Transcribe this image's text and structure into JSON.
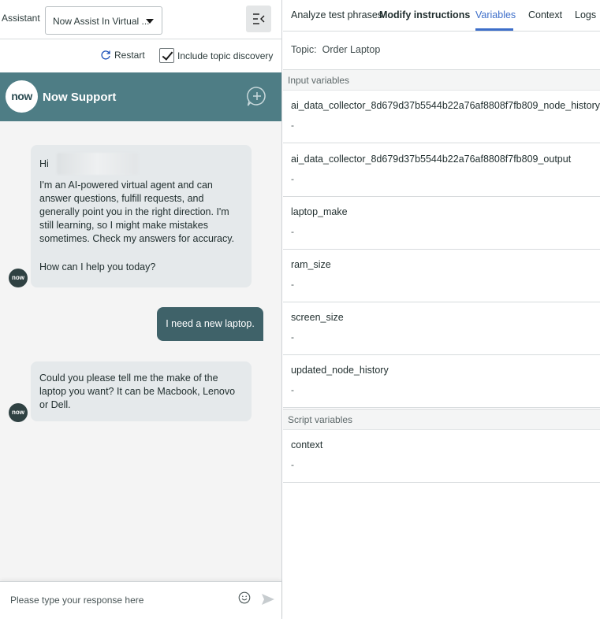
{
  "assistant": {
    "label": "Assistant",
    "selected": "Now Assist In Virtual ..."
  },
  "controls": {
    "restart_label": "Restart",
    "include_discovery_label": "Include topic discovery"
  },
  "chat": {
    "logo_text": "now",
    "title": "Now Support",
    "messages": {
      "greeting": "Hi",
      "intro": "I'm an AI-powered virtual agent and can answer questions, fulfill requests, and generally point you in the right direction. I'm still learning, so I might make mistakes sometimes. Check my answers for accuracy.",
      "question": "How can I help you today?",
      "user": "I need a new laptop.",
      "followup": "Could you please tell me the make of the laptop you want? It can be Macbook, Lenovo or Dell."
    },
    "avatar_text": "now",
    "input_placeholder": "Please type your response here"
  },
  "tabs": {
    "analyze": "Analyze test phrases",
    "modify": "Modify instructions",
    "variables": "Variables",
    "context": "Context",
    "logs": "Logs"
  },
  "topic": {
    "label": "Topic:",
    "name": "Order Laptop"
  },
  "input_variables": {
    "header": "Input variables",
    "items": [
      {
        "name": "ai_data_collector_8d679d37b5544b22a76af8808f7fb809_node_history",
        "value": "-"
      },
      {
        "name": "ai_data_collector_8d679d37b5544b22a76af8808f7fb809_output",
        "value": "-"
      },
      {
        "name": "laptop_make",
        "value": "-"
      },
      {
        "name": "ram_size",
        "value": "-"
      },
      {
        "name": "screen_size",
        "value": "-"
      },
      {
        "name": "updated_node_history",
        "value": "-"
      }
    ]
  },
  "script_variables": {
    "header": "Script variables",
    "items": [
      {
        "name": "context",
        "value": "-"
      }
    ]
  },
  "colors": {
    "header_teal": "#4e7d85",
    "user_bubble": "#3f6269",
    "active_tab": "#3d6ec9"
  }
}
